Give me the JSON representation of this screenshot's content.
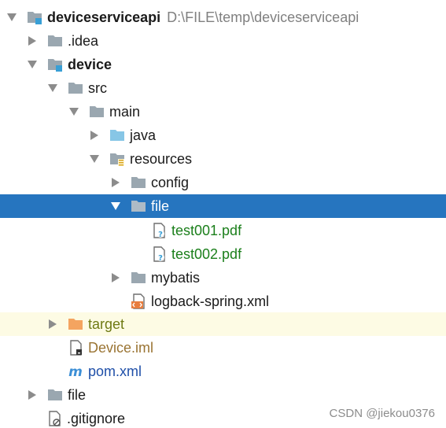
{
  "tree": {
    "root": {
      "name": "deviceserviceapi",
      "path": "D:\\FILE\\temp\\deviceserviceapi"
    },
    "idea": {
      "name": ".idea"
    },
    "device": {
      "name": "device"
    },
    "src": {
      "name": "src"
    },
    "main": {
      "name": "main"
    },
    "java": {
      "name": "java"
    },
    "resources": {
      "name": "resources"
    },
    "config": {
      "name": "config"
    },
    "file_dir": {
      "name": "file"
    },
    "test001": {
      "name": "test001.pdf"
    },
    "test002": {
      "name": "test002.pdf"
    },
    "mybatis": {
      "name": "mybatis"
    },
    "logback": {
      "name": "logback-spring.xml"
    },
    "target": {
      "name": "target"
    },
    "device_iml": {
      "name": "Device.iml"
    },
    "pom": {
      "name": "pom.xml"
    },
    "file_root": {
      "name": "file"
    },
    "gitignore": {
      "name": ".gitignore"
    }
  },
  "watermark": "CSDN @jiekou0376",
  "colors": {
    "selection": "#2675bf",
    "excluded_row": "#fdfbe4",
    "folder": "#9aa7b0",
    "source_folder": "#87c6e6",
    "excluded_folder": "#f4a460",
    "module_badge": "#389fd6"
  }
}
